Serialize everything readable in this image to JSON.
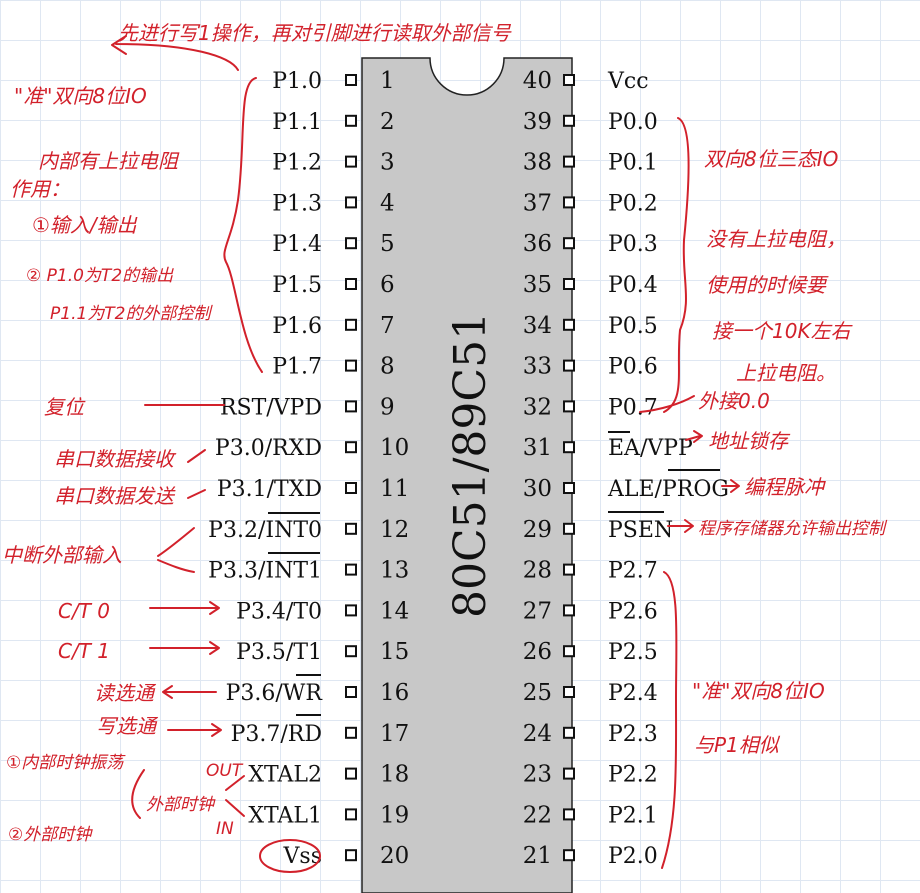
{
  "chip": {
    "name": "80C51/89C51",
    "left_pins": [
      {
        "num": "1",
        "label": "P1.0"
      },
      {
        "num": "2",
        "label": "P1.1"
      },
      {
        "num": "3",
        "label": "P1.2"
      },
      {
        "num": "4",
        "label": "P1.3"
      },
      {
        "num": "5",
        "label": "P1.4"
      },
      {
        "num": "6",
        "label": "P1.5"
      },
      {
        "num": "7",
        "label": "P1.6"
      },
      {
        "num": "8",
        "label": "P1.7"
      },
      {
        "num": "9",
        "label": "RST/VPD"
      },
      {
        "num": "10",
        "label": "P3.0/RXD"
      },
      {
        "num": "11",
        "label": "P3.1/TXD"
      },
      {
        "num": "12",
        "label": "P3.2/INT0"
      },
      {
        "num": "13",
        "label": "P3.3/INT1"
      },
      {
        "num": "14",
        "label": "P3.4/T0"
      },
      {
        "num": "15",
        "label": "P3.5/T1"
      },
      {
        "num": "16",
        "label": "P3.6/WR"
      },
      {
        "num": "17",
        "label": "P3.7/RD"
      },
      {
        "num": "18",
        "label": "XTAL2"
      },
      {
        "num": "19",
        "label": "XTAL1"
      },
      {
        "num": "20",
        "label": "Vss"
      }
    ],
    "right_pins": [
      {
        "num": "40",
        "label": "Vcc"
      },
      {
        "num": "39",
        "label": "P0.0"
      },
      {
        "num": "38",
        "label": "P0.1"
      },
      {
        "num": "37",
        "label": "P0.2"
      },
      {
        "num": "36",
        "label": "P0.3"
      },
      {
        "num": "35",
        "label": "P0.4"
      },
      {
        "num": "34",
        "label": "P0.5"
      },
      {
        "num": "33",
        "label": "P0.6"
      },
      {
        "num": "32",
        "label": "P0.7"
      },
      {
        "num": "31",
        "label": "EA/VPP"
      },
      {
        "num": "30",
        "label": "ALE/PROG"
      },
      {
        "num": "29",
        "label": "PSEN"
      },
      {
        "num": "28",
        "label": "P2.7"
      },
      {
        "num": "27",
        "label": "P2.6"
      },
      {
        "num": "26",
        "label": "P2.5"
      },
      {
        "num": "25",
        "label": "P2.4"
      },
      {
        "num": "24",
        "label": "P2.3"
      },
      {
        "num": "23",
        "label": "P2.2"
      },
      {
        "num": "22",
        "label": "P2.1"
      },
      {
        "num": "21",
        "label": "P2.0"
      }
    ]
  },
  "annotations": {
    "top_note": "先进行写1操作，再对引脚进行读取外部信号",
    "p1_title": "\"准\"双向8位IO",
    "p1_pullup": "内部有上拉电阻",
    "p1_use": "作用：",
    "p1_use1": "①输入/输出",
    "p1_use2": "② P1.0为T2的输出",
    "p1_use3": "P1.1为T2的外部控制",
    "rst": "复位",
    "rxd": "串口数据接收",
    "txd": "串口数据发送",
    "int": "中断外部输入",
    "t0": "C/T 0",
    "t1": "C/T 1",
    "wr": "读选通",
    "rd": "写选通",
    "clk1": "①内部时钟振荡",
    "clk_ext": "外部时钟",
    "clk2": "②外部时钟",
    "out": "OUT",
    "in": "IN",
    "p0_title": "双向8位三态IO",
    "p0_l1": "没有上拉电阻，",
    "p0_l2": "使用的时候要",
    "p0_l3": "接一个10K左右",
    "p0_l4": "上拉电阻。",
    "p07": "外接0.0",
    "ea": "地址锁存",
    "ale": "编程脉冲",
    "psen": "程序存储器允许输出控制",
    "p2_l1": "\"准\"双向8位IO",
    "p2_l2": "与P1相似"
  },
  "colors": {
    "ink": "#d2212b",
    "chip_fill": "#c8c8c8",
    "grid": "#dfe7f2"
  }
}
